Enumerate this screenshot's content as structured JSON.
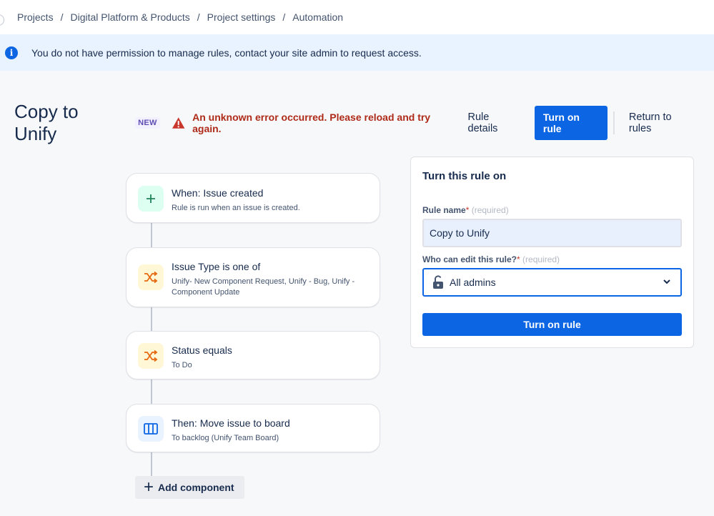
{
  "breadcrumb": [
    "Projects",
    "Digital Platform & Products",
    "Project settings",
    "Automation"
  ],
  "banner": {
    "icon": "info-icon",
    "text": "You do not have permission to manage rules, contact your site admin to request access."
  },
  "header": {
    "title": "Copy to Unify",
    "badge": "NEW",
    "error_icon": "warning-icon",
    "error": "An unknown error occurred. Please reload and try again.",
    "rule_details": "Rule details",
    "turn_on": "Turn on rule",
    "return": "Return to rules"
  },
  "rule": {
    "components": [
      {
        "icon": "plus-icon",
        "title": "When: Issue created",
        "subtitle": "Rule is run when an issue is created."
      },
      {
        "icon": "shuffle-icon",
        "title": "Issue Type is one of",
        "subtitle": "Unify- New Component Request, Unify - Bug, Unify - Component Update"
      },
      {
        "icon": "shuffle-icon",
        "title": "Status equals",
        "subtitle": "To Do"
      },
      {
        "icon": "board-icon",
        "title": "Then: Move issue to board",
        "subtitle": "To backlog (Unify Team Board)"
      }
    ],
    "add_component": "Add component"
  },
  "panel": {
    "heading": "Turn this rule on",
    "name_label": "Rule name",
    "required_mark": "*",
    "required_text": "(required)",
    "name_value": "Copy to Unify",
    "edit_label": "Who can edit this rule?",
    "edit_value": "All admins",
    "button": "Turn on rule"
  },
  "colors": {
    "primary": "#0c66e4",
    "error": "#ae2a19",
    "banner_bg": "#e9f2ff",
    "trigger_bg": "#dcfff1",
    "condition_bg": "#fff7d6",
    "action_bg": "#e9f2ff"
  }
}
